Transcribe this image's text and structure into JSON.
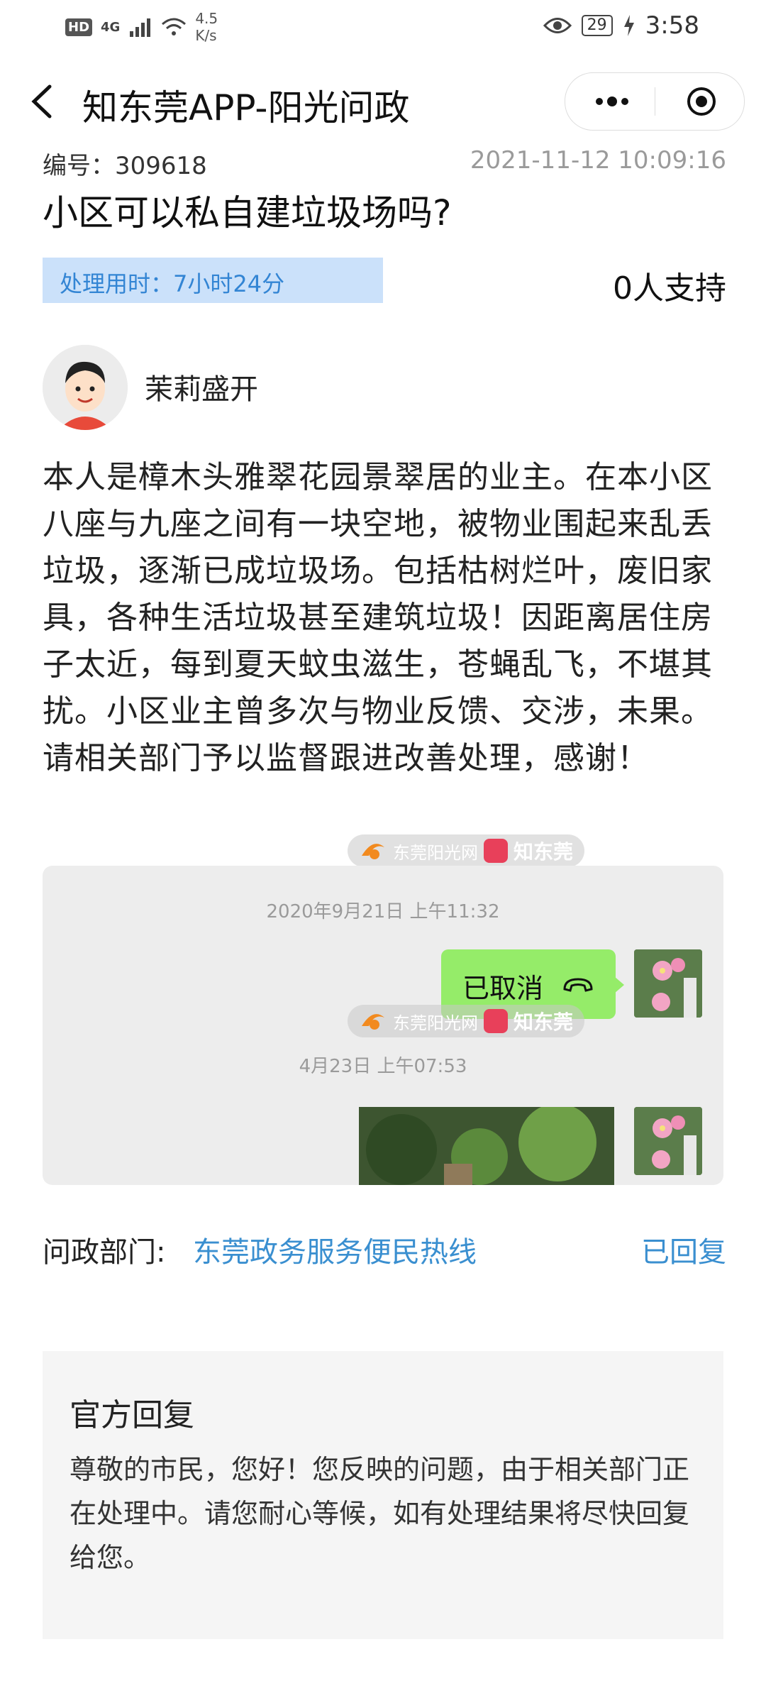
{
  "status_bar": {
    "hd": "HD",
    "network": "4G",
    "speed_value": "4.5",
    "speed_unit": "K/s",
    "battery": "29",
    "time": "3:58"
  },
  "nav": {
    "title": "知东莞APP-阳光问政",
    "more_icon": "more-dots-icon",
    "close_icon": "record-circle-icon"
  },
  "post": {
    "number_label": "编号：309618",
    "date": "2021-11-12 10:09:16",
    "title": "小区可以私自建垃圾场吗?",
    "processing_time": "处理用时：7小时24分",
    "support": "0人支持",
    "author": "茉莉盛开",
    "content": "本人是樟木头雅翠花园景翠居的业主。在本小区八座与九座之间有一块空地，被物业围起来乱丢垃圾，逐渐已成垃圾场。包括枯树烂叶，废旧家具，各种生活垃圾甚至建筑垃圾！因距离居住房子太近，每到夏天蚊虫滋生，苍蝇乱飞，不堪其扰。小区业主曾多次与物业反馈、交涉，未果。请相关部门予以监督跟进改善处理，感谢！"
  },
  "watermark": {
    "site": "东莞阳光网",
    "site_url": "sun0769.com",
    "app": "知东莞"
  },
  "chat": {
    "timestamp1": "2020年9月21日 上午11:32",
    "bubble_text": "已取消",
    "timestamp2": "4月23日 上午07:53"
  },
  "department": {
    "label": "问政部门:",
    "name": "东莞政务服务便民热线",
    "status": "已回复"
  },
  "reply": {
    "title": "官方回复",
    "text": "尊敬的市民，您好！您反映的问题，由于相关部门正在处理中。请您耐心等候，如有处理结果将尽快回复给您。"
  },
  "colors": {
    "accent_blue": "#3a8fd0",
    "time_box_bg": "#cbe1fa",
    "chat_bubble": "#95ec69"
  }
}
